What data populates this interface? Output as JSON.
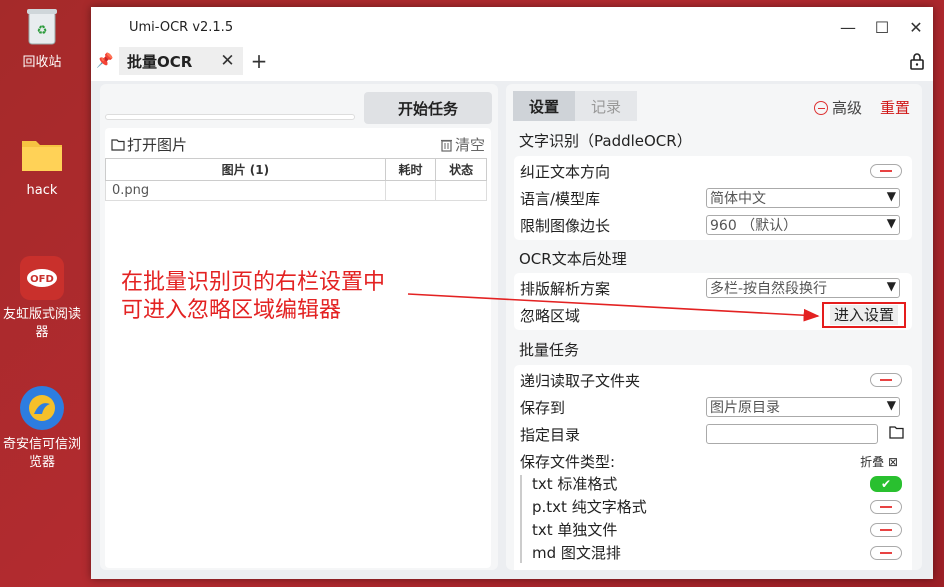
{
  "desktop": {
    "icons": [
      {
        "label": "回收站"
      },
      {
        "label": "hack"
      },
      {
        "label": "友虹版式阅读器"
      },
      {
        "label": "奇安信可信浏览器"
      }
    ]
  },
  "window": {
    "title": "Umi-OCR v2.1.5",
    "tab_label": "批量OCR"
  },
  "left": {
    "start_button": "开始任务",
    "open_images": "打开图片",
    "clear": "清空",
    "columns": [
      "图片 (1)",
      "耗时",
      "状态"
    ],
    "rows": [
      {
        "name": "0.png",
        "time": "",
        "status": ""
      }
    ]
  },
  "right": {
    "tabs": [
      "设置",
      "记录"
    ],
    "advanced": "高级",
    "reset": "重置",
    "sections": {
      "ocr": "文字识别（PaddleOCR）",
      "post": "OCR文本后处理",
      "batch": "批量任务"
    },
    "ocr_rows": {
      "correct_direction": "纠正文本方向",
      "language": "语言/模型库",
      "language_value": "简体中文",
      "limit_side": "限制图像边长",
      "limit_side_value": "960 （默认）"
    },
    "post_rows": {
      "layout": "排版解析方案",
      "layout_value": "多栏-按自然段换行",
      "ignore_area": "忽略区域",
      "enter_settings": "进入设置"
    },
    "batch_rows": {
      "recursive": "递归读取子文件夹",
      "save_to": "保存到",
      "save_to_value": "图片原目录",
      "specify_dir": "指定目录",
      "file_types": "保存文件类型:",
      "fold": "折叠",
      "types": [
        "txt 标准格式",
        "p.txt 纯文字格式",
        "txt 单独文件",
        "md 图文混排"
      ],
      "types_enabled": [
        true,
        false,
        false,
        false
      ]
    }
  },
  "annotation": {
    "line1": "在批量识别页的右栏设置中",
    "line2": "可进入忽略区域编辑器"
  },
  "colors": {
    "accent_red": "#e32222",
    "toggle_on": "#29c02f"
  }
}
